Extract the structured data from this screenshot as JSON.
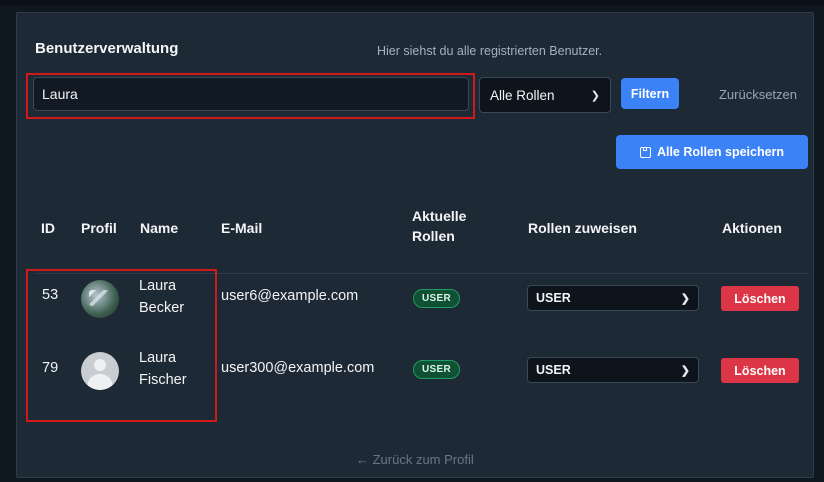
{
  "header": {
    "title": "Benutzerverwaltung",
    "subtitle": "Hier siehst du alle registrierten Benutzer."
  },
  "filter": {
    "search_value": "Laura",
    "role_select_value": "Alle Rollen",
    "filter_label": "Filtern",
    "reset_label": "Zurücksetzen"
  },
  "save_all_label": "Alle Rollen speichern",
  "table": {
    "columns": [
      "ID",
      "Profil",
      "Name",
      "E-Mail",
      "Aktuelle Rollen",
      "Rollen zuweisen",
      "Aktionen"
    ],
    "rows": [
      {
        "id": "53",
        "first": "Laura",
        "last": "Becker",
        "email": "user6@example.com",
        "role_badge": "USER",
        "assign_value": "USER",
        "delete_label": "Löschen"
      },
      {
        "id": "79",
        "first": "Laura",
        "last": "Fischer",
        "email": "user300@example.com",
        "role_badge": "USER",
        "assign_value": "USER",
        "delete_label": "Löschen"
      }
    ]
  },
  "footer": {
    "back_label": "← Zurück zum Profil"
  },
  "colors": {
    "accent": "#3b82f6",
    "danger": "#dc3545",
    "badge": "#0f5132",
    "highlight": "#d11919"
  },
  "icons": [
    "save-icon",
    "chevron-down-icon",
    "avatar"
  ]
}
